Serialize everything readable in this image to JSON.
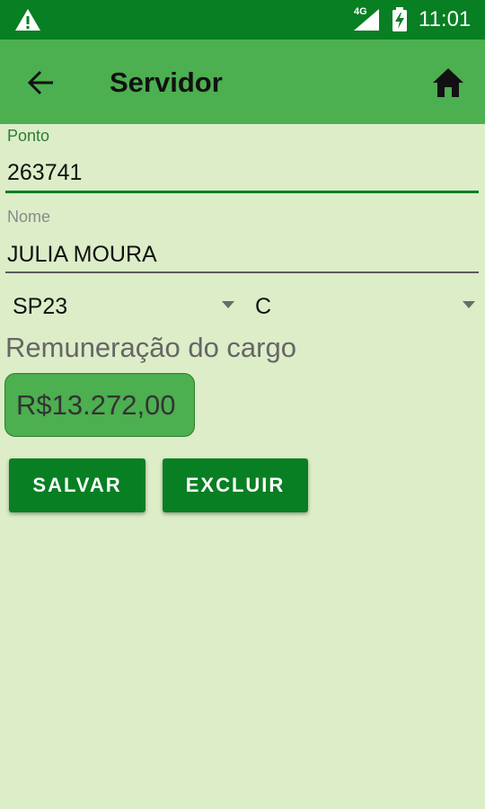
{
  "status_bar": {
    "time": "11:01",
    "network": "4G",
    "icons": [
      "warning-icon",
      "signal-icon",
      "battery-charging-icon"
    ]
  },
  "app_bar": {
    "title": "Servidor",
    "back_icon": "arrow-left-icon",
    "home_icon": "home-icon",
    "background": "#4caf50"
  },
  "form": {
    "ponto": {
      "label": "Ponto",
      "value": "263741"
    },
    "nome": {
      "label": "Nome",
      "value": "JULIA MOURA"
    },
    "spinner_1": {
      "selected": "SP23"
    },
    "spinner_2": {
      "selected": "C"
    },
    "remuneracao": {
      "title": "Remuneração do cargo",
      "value": "R$13.272,00"
    }
  },
  "actions": {
    "save_label": "SALVAR",
    "delete_label": "EXCLUIR"
  },
  "colors": {
    "primary_dark": "#087f23",
    "primary": "#4caf50",
    "background": "#dcedc8"
  }
}
